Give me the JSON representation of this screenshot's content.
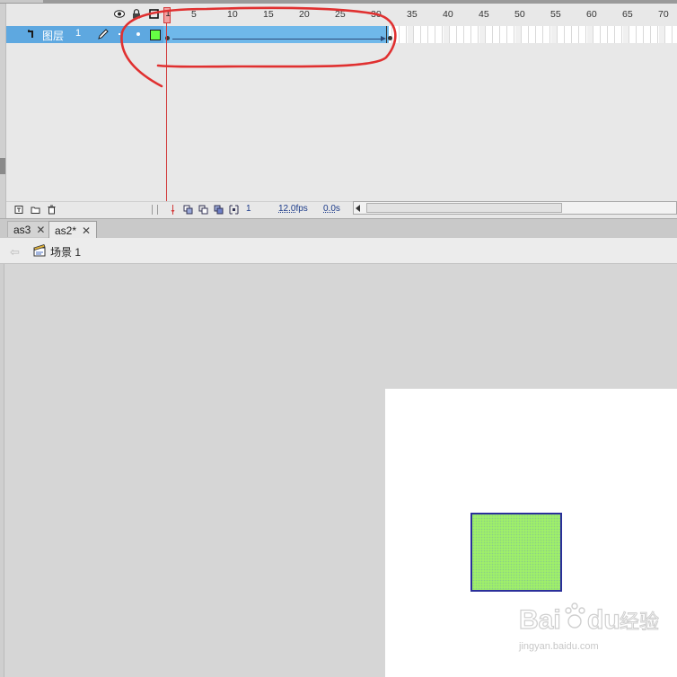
{
  "timeline": {
    "layer": {
      "name": "图层",
      "number": "1"
    },
    "playhead_frame": "1",
    "ruler_ticks": [
      "5",
      "10",
      "15",
      "20",
      "25",
      "30",
      "35",
      "40",
      "45",
      "50",
      "55",
      "60",
      "65",
      "70"
    ],
    "footer": {
      "current_frame": "1",
      "frame_rate": "12.0",
      "frame_rate_unit": "fps",
      "elapsed": "0.0",
      "elapsed_unit": "s"
    }
  },
  "tabs": [
    {
      "label": "as3",
      "close": "✕",
      "active": false
    },
    {
      "label": "as2*",
      "close": "✕",
      "active": true
    }
  ],
  "scene": {
    "back_arrow": "⇦",
    "label": "场景 1"
  },
  "watermark": {
    "text": "Baidu 经验",
    "url": "jingyan.baidu.com"
  },
  "colors": {
    "layer_highlight": "#5ea8e0",
    "frame_span": "#6fb8ea",
    "playhead": "#d23a3a",
    "annotation": "#e03030",
    "shape_fill": "#9ff06a",
    "shape_stroke": "#2a2f9a",
    "stage": "#ffffff",
    "pasteboard": "#d6d6d6"
  }
}
